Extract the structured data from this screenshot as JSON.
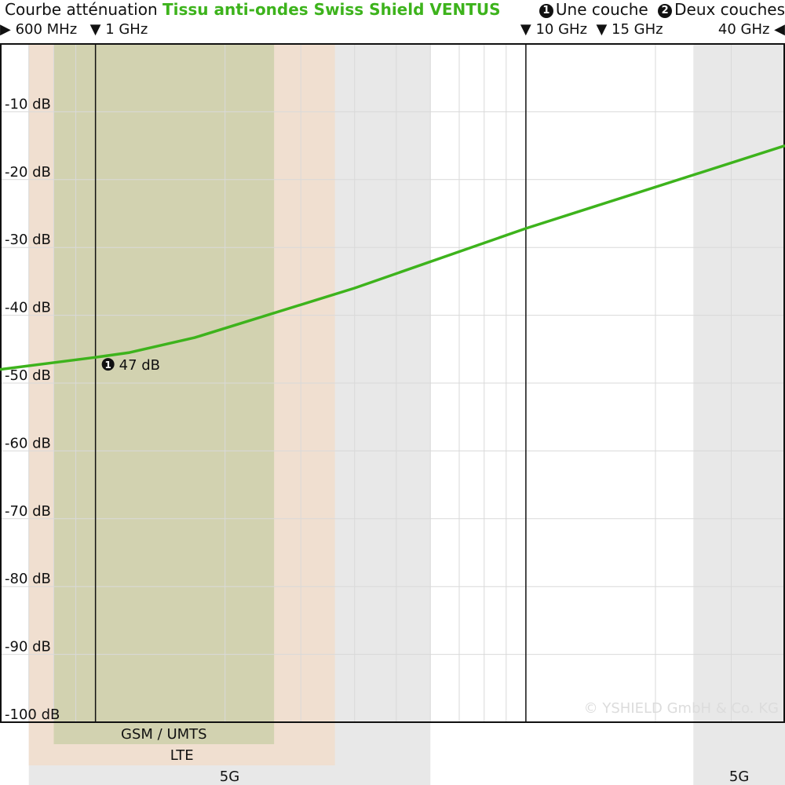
{
  "header": {
    "title_prefix": "Courbe atténuation",
    "title_product": "Tissu anti-ondes Swiss Shield VENTUS",
    "legend": [
      {
        "marker": "1",
        "label": "Une couche"
      },
      {
        "marker": "2",
        "label": "Deux couches"
      }
    ]
  },
  "colors": {
    "accent": "#3db31c",
    "band_5g": "#e8e8e8",
    "band_lte": "#f0dfd0",
    "band_gsm": "#d2d2b0",
    "grid": "#d9d9d9",
    "frame": "#111111"
  },
  "chart_data": {
    "type": "line",
    "title": "Courbe atténuation Tissu anti-ondes Swiss Shield VENTUS",
    "x_scale": "log",
    "x_unit": "MHz",
    "xlim": [
      600,
      40000
    ],
    "ylim": [
      -100,
      0
    ],
    "grid": true,
    "freq_labels": [
      {
        "text": "600 MHz",
        "mhz": 600,
        "marker": "right"
      },
      {
        "text": "1 GHz",
        "mhz": 1000,
        "marker": "down"
      },
      {
        "text": "10 GHz",
        "mhz": 10000,
        "marker": "down"
      },
      {
        "text": "15 GHz",
        "mhz": 15000,
        "marker": "down"
      },
      {
        "text": "40 GHz",
        "mhz": 40000,
        "marker": "left"
      }
    ],
    "y_ticks": [
      {
        "value": -10,
        "label": "-10 dB"
      },
      {
        "value": -20,
        "label": "-20 dB"
      },
      {
        "value": -30,
        "label": "-30 dB"
      },
      {
        "value": -40,
        "label": "-40 dB"
      },
      {
        "value": -50,
        "label": "-50 dB"
      },
      {
        "value": -60,
        "label": "-60 dB"
      },
      {
        "value": -70,
        "label": "-70 dB"
      },
      {
        "value": -80,
        "label": "-80 dB"
      },
      {
        "value": -90,
        "label": "-90 dB"
      },
      {
        "value": -100,
        "label": "-100 dB"
      }
    ],
    "bands": [
      {
        "label": "5G",
        "from_mhz": 700,
        "to_mhz": 6000,
        "color": "#e8e8e8",
        "row": 3
      },
      {
        "label": "5G",
        "from_mhz": 24500,
        "to_mhz": 40000,
        "color": "#e8e8e8",
        "row": 3
      },
      {
        "label": "LTE",
        "from_mhz": 700,
        "to_mhz": 3600,
        "color": "#f0dfd0",
        "row": 2
      },
      {
        "label": "GSM / UMTS",
        "from_mhz": 800,
        "to_mhz": 2600,
        "color": "#d2d2b0",
        "row": 1
      }
    ],
    "series": [
      {
        "name": "Une couche",
        "color": "#3db31c",
        "x": [
          600,
          1000,
          1200,
          1700,
          4000,
          10000,
          40000
        ],
        "y": [
          -48,
          -46.2,
          -45.5,
          -43.3,
          -36,
          -27.2,
          -15
        ]
      }
    ],
    "annotation": {
      "marker": "1",
      "label": "47 dB",
      "mhz": 1000,
      "value": -47
    },
    "copyright": "© YSHIELD GmbH & Co. KG"
  }
}
